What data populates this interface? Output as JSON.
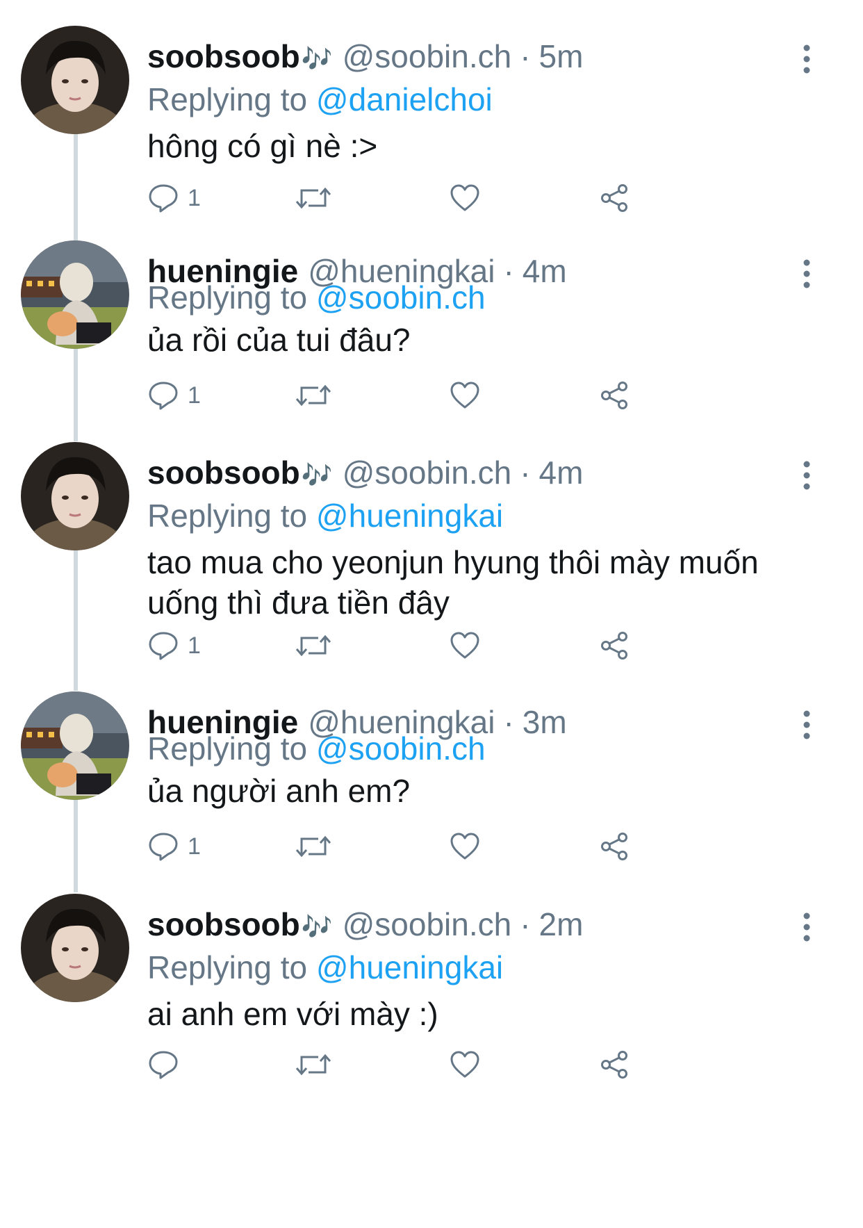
{
  "tweets": [
    {
      "display_name": "soobsoob",
      "emoji": "🎶",
      "handle": "@soobin.ch",
      "dot": "·",
      "time": "5m",
      "reply_label": "Replying to",
      "reply_target": "@danielchoi",
      "text": "hông có gì nè :>",
      "reply_count": "1"
    },
    {
      "display_name": "hueningie",
      "emoji": "",
      "handle": "@hueningkai",
      "dot": "·",
      "time": "4m",
      "reply_label": "Replying to",
      "reply_target": "@soobin.ch",
      "text": "ủa rồi của tui đâu?",
      "reply_count": "1"
    },
    {
      "display_name": "soobsoob",
      "emoji": "🎶",
      "handle": "@soobin.ch",
      "dot": "·",
      "time": "4m",
      "reply_label": "Replying to",
      "reply_target": "@hueningkai",
      "text": "tao mua cho yeonjun hyung thôi mày muốn uống thì đưa tiền đây",
      "reply_count": "1"
    },
    {
      "display_name": "hueningie",
      "emoji": "",
      "handle": "@hueningkai",
      "dot": "·",
      "time": "3m",
      "reply_label": "Replying to",
      "reply_target": "@soobin.ch",
      "text": "ủa người anh em?",
      "reply_count": "1"
    },
    {
      "display_name": "soobsoob",
      "emoji": "🎶",
      "handle": "@soobin.ch",
      "dot": "·",
      "time": "2m",
      "reply_label": "Replying to",
      "reply_target": "@hueningkai",
      "text": "ai anh em với mày :)",
      "reply_count": ""
    }
  ],
  "icons": {
    "reply": "reply-icon",
    "retweet": "retweet-icon",
    "like": "heart-icon",
    "share": "share-icon",
    "more": "more-vertical-icon"
  },
  "colors": {
    "link": "#1da1f2",
    "secondary": "#657786",
    "thread_line": "#cfd9de"
  }
}
